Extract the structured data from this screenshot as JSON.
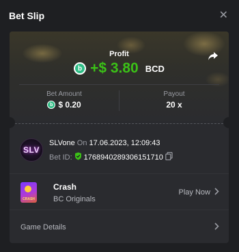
{
  "header": {
    "title": "Bet Slip"
  },
  "profit": {
    "label": "Profit",
    "coin_letter": "b",
    "amount": "+$ 3.80",
    "currency": "BCD",
    "amount_color": "#3bc117"
  },
  "stats": {
    "bet_amount_label": "Bet Amount",
    "bet_amount_value": "$ 0.20",
    "payout_label": "Payout",
    "payout_value": "20 x"
  },
  "user": {
    "avatar_text": "SLV",
    "name": "SLVone",
    "on_word": "On",
    "datetime": "17.06.2023, 12:09:43",
    "bet_id_label": "Bet ID:",
    "bet_id": "176894028930615171​0"
  },
  "game": {
    "name": "Crash",
    "provider": "BC Originals",
    "thumb_label": "CRASH",
    "play_label": "Play Now"
  },
  "details": {
    "label": "Game Details"
  },
  "icons": [
    "close-icon",
    "share-icon",
    "coin-icon",
    "shield-check-icon",
    "copy-icon",
    "chevron-right-icon"
  ]
}
